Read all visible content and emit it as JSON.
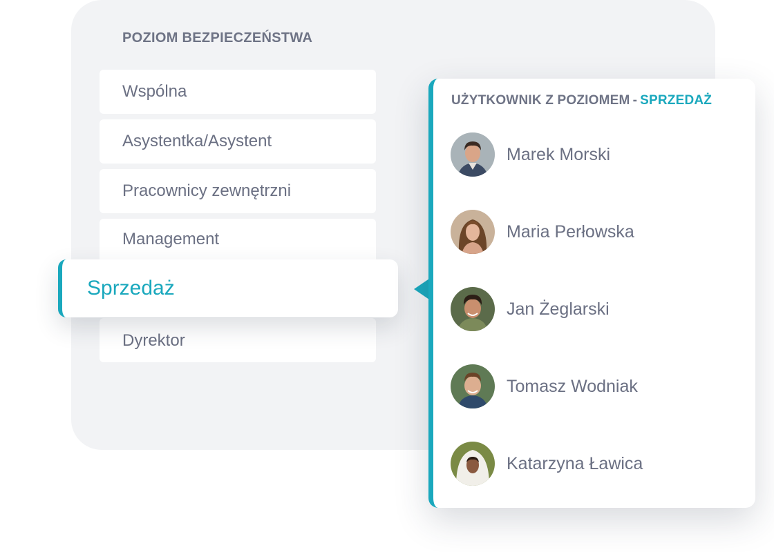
{
  "levels": {
    "heading": "POZIOM BEZPIECZEŃSTWA",
    "items": [
      {
        "label": "Wspólna"
      },
      {
        "label": "Asystentka/Asystent"
      },
      {
        "label": "Pracownicy zewnętrzni"
      },
      {
        "label": "Management"
      },
      {
        "label": "Sprzedaż",
        "selected": true
      },
      {
        "label": "Dyrektor"
      }
    ]
  },
  "users_card": {
    "heading_prefix": "UŻYTKOWNIK Z POZIOMEM",
    "heading_separator": "-",
    "heading_level": "SPRZEDAŻ",
    "users": [
      {
        "name": "Marek Morski",
        "avatar": "avatar-photo"
      },
      {
        "name": "Maria Perłowska",
        "avatar": "avatar-photo"
      },
      {
        "name": "Jan Żeglarski",
        "avatar": "avatar-photo"
      },
      {
        "name": "Tomasz Wodniak",
        "avatar": "avatar-photo"
      },
      {
        "name": "Katarzyna Ławica",
        "avatar": "avatar-photo"
      }
    ]
  },
  "colors": {
    "accent": "#1aa8bd",
    "panel_bg": "#f2f3f5",
    "text": "#6b7083"
  }
}
